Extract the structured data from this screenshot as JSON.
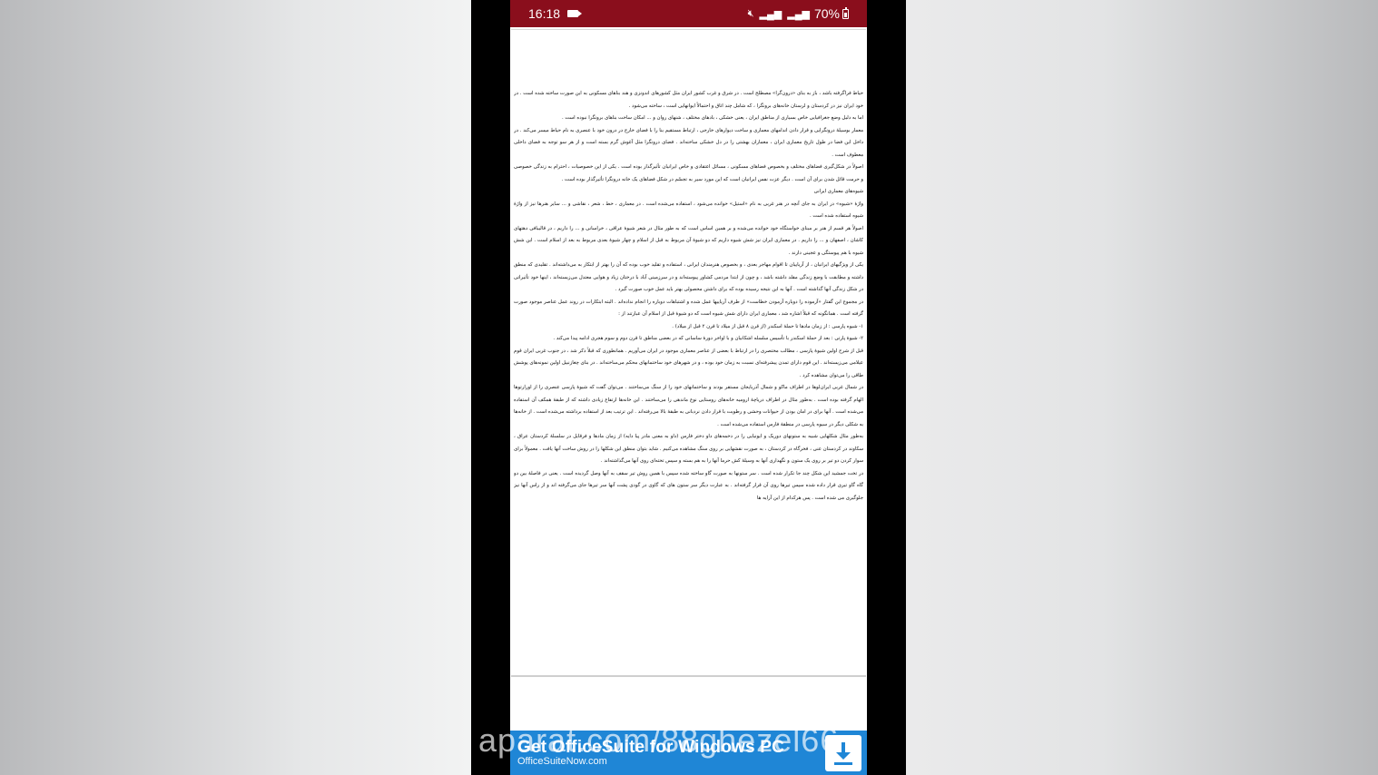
{
  "status_bar": {
    "time": "16:18",
    "recording_icon": "video-camera-icon",
    "mute_icon": "mute-icon",
    "signal_icons": [
      "signal-icon",
      "signal-icon"
    ],
    "battery_text": "70%",
    "battery_icon": "battery-charging-icon",
    "color": "#8a0e1c"
  },
  "document": {
    "paragraphs": [
      "حیاط فراگرفته باشد ، باز به بنای «درون‌گرا» مصطلح است . در شرق و غرب کشور ایران مثل کشورهای اندونزی و هند بناهای مسکونی به این صورت ساخته شده است . در خود ایران نیز در کردستان و لرستان خانه‌های برونگرا ، که شامل چند اتاق و احتمالاً ایوانهایی است ، ساخته می‌شود .",
      "اما به دلیل وضع جغرافیایی خاص بسیاری از مناطق ایران ، یعنی خشکی ، بادهای مختلف ، شنهای روان و ... امکان ساخت بناهای برونگرا نبوده است .",
      "معمار بوسیلهٔ درونگرایی و قرار دادن اندامهای معماری و ساخت دیوارهای خارجی ، ارتباط مستقیم بنا را با فضای خارج در درون خود با عنصری به نام حیاط میسر می‌کند . در داخل این فضا در طول تاریخ معماری ایران ، معماران بهشتی را در دل خشکی ساخته‌اند . فضای درونگرا مثل آغوش گرم بسته است و از هر سو توجه به فضای داخلی معطوف است .",
      "اصولاً در شکل‌گیری فضاهای مختلف و بخصوص فضاهای مسکونی ، مسائل اعتقادی و خاص ایرانیان تأثیرگذار بوده است . یکی از این خصوصیات ، احترام به زندگی خصوصی و حرمت قائل شدن برای آن است . دیگر عزت نفس ایرانیان است که این مورد سیر به تجسّم در شکل فضاهای یک خانه درونگرا تأثیرگذار بوده است .",
      "شیوه‌های معماری ایرانی",
      "واژهٔ «شیوه» در ایران به جای آنچه در هنر غربی به نام «استیل» خوانده می‌شود ، استفاده می‌شده است . در معماری ، خط ، شعر ، نقاشی و ... سایر هنرها نیز از واژهٔ شیوه استفاده شده است .",
      "اصولاً هر قسم از هنر بر مبنای خواستگاه خود خوانده می‌شده و بر همین اساس است که به طور مثال در شعر شیوهٔ عراقی ، خراسانی و ... را داریم ، در قالیبافی دهتهای کاشان ، اصفهان و ... را داریم . در معماری ایران نیز شش شیوه داریم که دو شیوهٔ آن مربوط به قبل از اسلام و چهار شیوهٔ بعدی مربوط به بعد از اسلام است . این شش شیوه با هم پیوستگی و عجینی دارند .",
      "یکی از ویژگیهای ایرانیان ، از آریاییان تا اقوام مهاجر بعدی ، و بخصوص هنرمندان ایرانی ، استفاده و تقلید خوب بوده که آن را بهتر از ابتکار به می‌داشته‌اند . تقلیدی که منطق داشته و مطابقت با وضع زندگی مقلد داشته باشد ، و چون از ابتدا مردمی کشاور پیوسته‌اند و در سرزمینی آباد با درختان زیاد و هوایی معتدل می‌زیسته‌اند ، اینها خود تأثیراتی در شکل زندگی آنها گذاشته است . آنها به این نتیجه رسیده بوده که برای داشتن محصولی بهتر باید عمل خوب صورت گیرد .",
      "در مجموع این گفتار «آزموده را دوباره آزمودن خطاست» از طرف آریاییها عمل شده و اشتباهات دوباره را انجام نداده‌اند . البته ابتکارات در روند عمل عناصر موجود صورت گرفته است . همانگونه که قبلاً اشاره شد ، معماری ایران دارای شش شیوه است که دو شیوهٔ قبل از اسلام آن عبارتند از :",
      "۱- شیوه پارسی : از زمان مادها تا حملهٔ اسکندر (از قرن ۸ قبل از میلاد تا قرن ۲ قبل از میلاد) .",
      "۲- شیوهٔ پارتی : بعد از حملهٔ اسکندر با تأسیس سلسله اشکانیان و با اواخر دورهٔ ساسانی که در بعضی مناطق تا قرن دوم و سوم هجری ادامه پیدا می‌کند .",
      "قبل از شرح اولین شیوهٔ پارسی ، مطالب مختصری را در ارتباط با بعضی از عناصر معماری موجود در ایران می‌آوریم . همانطوری که قبلاً ذکر شد ، در جنوب غربی ایران قوم عیلامی می‌زیسته‌اند . این قوم دارای تمدن پیشرفته‌ای نسبت به زمان خود بوده ، و در شهرهای خود ساختمانهای محکم می‌ساخته‌اند . در بنای چغازنبیل اولین نمونه‌های پوشش طاقی را می‌توان مشاهده کرد .",
      "در شمال غربی ایران‌لوها در اطراف ماکو و شمال آذربایجان مستقر بودند و ساختمانهای خود را از سنگ می‌ساختند . می‌توان گفت که شیوهٔ پارسی عنصری را از اورارتوها الهام گرفته بوده است . به‌طور مثال در اطراف دریاچهٔ ارومیه خانه‌های روستایی نوع ماندهی را می‌ساختند . این خانه‌ها ارتفاع زیادی داشته که از طبقهٔ همکف آن استفاده می‌شده است . آنها برای در امان بودن از حیوانات وحشی و رطوبت با قرار دادن نردبانی به طبقهٔ بالا می‌رفته‌اند . این ترتیب بعد از استفاده برداشته می‌شده است . از خانه‌ها به شکلی دیگر در سیوه پارسی در منطقهٔ فارس استفاده می‌شده است .",
      "به‌طور مثال شکلهایی شبیه به ستونهای دوریک و ایونیایی را در دخمه‌های داو دختر فارس (داو به معنی مادر پیا دایه) از زمان مادها و فرقایل در سلسلهٔ کردستان عراق ، سکاوند در کردستان عنی ، فخرگاه در کردستان ، به صورت نقشهایی بر روی سنگ مشاهده می‌کنیم . شاید بتوان منطق این شکلها را در روش ساخت آنها یافت . معمولاً برای سوار کردن دو تیر بر روی یک ستون و نگهداری آنها به وسیلهٔ کش حرما آنها را به هم بسته و سپس تخته‌ای روی آنها می‌گذاشته‌اند .",
      "در تخت جمشید این شکل چند جا تکرار شده است . سر ستونها به صورت گاو ساخته شده سپس با همین روش تیر سقف به آنها وصل گردیده است . یعنی در فاصلهٔ بین دو گاه گاو تیری قرار داده شده سپس تیرها روی آن قرار گرفته‌اند . به عبارت دیگر سر ستون های که گاوی در گودی پشت آنها سر تیرها جای می‌گرفته اند و از راس آنها نیز جلوگیری می شده است . پس هرکدام از این آرایه ها"
    ]
  },
  "ad": {
    "title": "Get OfficeSuite for Windows PC",
    "subtitle": "OfficeSuiteNow.com",
    "icon": "download-icon",
    "color": "#1f86d6"
  },
  "watermark": {
    "text": "aparat.com/88ghezel66"
  }
}
